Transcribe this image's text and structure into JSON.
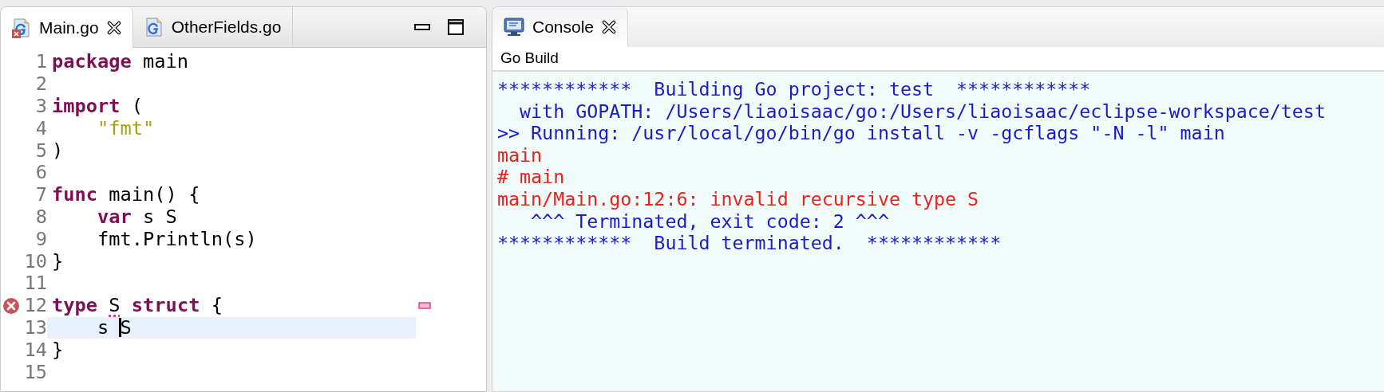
{
  "editor": {
    "tabs": [
      {
        "label": "Main.go",
        "selected": true,
        "error": true,
        "closable": true
      },
      {
        "label": "OtherFields.go",
        "selected": false,
        "error": false,
        "closable": false
      }
    ],
    "lines": [
      {
        "number": "1",
        "tokens": [
          {
            "text": "package",
            "kind": "keyword"
          },
          {
            "text": " main",
            "kind": "plain"
          }
        ]
      },
      {
        "number": "2"
      },
      {
        "number": "3",
        "tokens": [
          {
            "text": "import",
            "kind": "keyword"
          },
          {
            "text": " (",
            "kind": "plain"
          }
        ]
      },
      {
        "number": "4",
        "tokens": [
          {
            "text": "    \"fmt\"",
            "kind": "string"
          }
        ]
      },
      {
        "number": "5",
        "tokens": [
          {
            "text": ")",
            "kind": "plain"
          }
        ]
      },
      {
        "number": "6"
      },
      {
        "number": "7",
        "tokens": [
          {
            "text": "func",
            "kind": "keyword"
          },
          {
            "text": " main() {",
            "kind": "plain"
          }
        ]
      },
      {
        "number": "8",
        "tokens": [
          {
            "text": "    var",
            "kind": "keyword"
          },
          {
            "text": " s S",
            "kind": "plain"
          }
        ]
      },
      {
        "number": "9",
        "tokens": [
          {
            "text": "    fmt.Println(s)",
            "kind": "plain"
          }
        ]
      },
      {
        "number": "10",
        "tokens": [
          {
            "text": "}",
            "kind": "plain"
          }
        ]
      },
      {
        "number": "11"
      },
      {
        "number": "12",
        "error": true,
        "tokens": [
          {
            "text": "type ",
            "kind": "keyword"
          },
          {
            "text": "S",
            "kind": "problem"
          },
          {
            "text": " struct",
            "kind": "keyword"
          },
          {
            "text": " {",
            "kind": "plain"
          }
        ]
      },
      {
        "number": "13",
        "current": true,
        "tokens": [
          {
            "text": "    s ",
            "kind": "plain"
          },
          {
            "text": "S",
            "kind": "plain"
          }
        ]
      },
      {
        "number": "14",
        "tokens": [
          {
            "text": "}",
            "kind": "plain"
          }
        ]
      },
      {
        "number": "15"
      }
    ]
  },
  "console": {
    "tab": {
      "label": "Console",
      "selected": true
    },
    "title": "Go Build",
    "lines": [
      {
        "text": "************  Building Go project: test  ************",
        "kind": "info"
      },
      {
        "text": "  with GOPATH: /Users/liaoisaac/go:/Users/liaoisaac/eclipse-workspace/test",
        "kind": "info"
      },
      {
        "text": ">> Running: /usr/local/go/bin/go install -v -gcflags \"-N -l\" main",
        "kind": "info"
      },
      {
        "text": "main",
        "kind": "error"
      },
      {
        "text": "# main",
        "kind": "error"
      },
      {
        "text": "main/Main.go:12:6: invalid recursive type S",
        "kind": "error"
      },
      {
        "text": "   ^^^ Terminated, exit code: 2 ^^^",
        "kind": "info"
      },
      {
        "text": "************  Build terminated.  ************",
        "kind": "info"
      }
    ]
  }
}
